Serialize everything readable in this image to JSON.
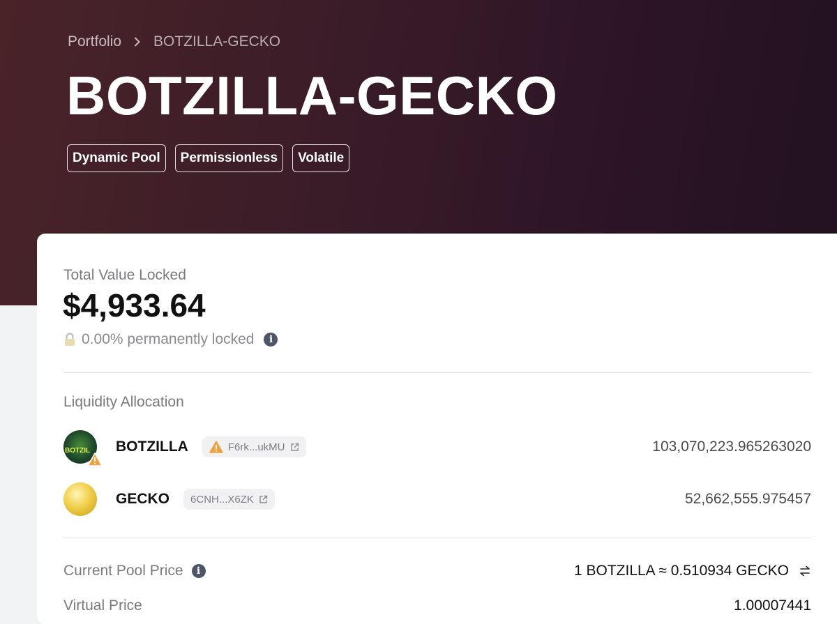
{
  "breadcrumb": {
    "root": "Portfolio",
    "current": "BOTZILLA-GECKO"
  },
  "page_title": "BOTZILLA-GECKO",
  "tags": [
    "Dynamic Pool",
    "Permissionless",
    "Volatile"
  ],
  "tvl": {
    "label": "Total Value Locked",
    "value": "$4,933.64",
    "locked_text": "0.00% permanently locked",
    "info_icon": "info-icon"
  },
  "allocation": {
    "label": "Liquidity Allocation",
    "tokens": [
      {
        "symbol": "BOTZILLA",
        "avatar_text": "BOTZIL",
        "address": "F6rk...ukMU",
        "warning": true,
        "amount": "103,070,223.965263020"
      },
      {
        "symbol": "GECKO",
        "address": "6CNH...X6ZK",
        "warning": false,
        "amount": "52,662,555.975457"
      }
    ]
  },
  "price": {
    "label": "Current Pool Price",
    "value": "1 BOTZILLA ≈ 0.510934 GECKO",
    "swap_icon": "swap-arrows-icon"
  },
  "next_row": {
    "label": "Virtual Price",
    "value": "1.00007441"
  },
  "colors": {
    "hero_start": "#4a2329",
    "hero_end": "#22111f",
    "warning": "#f0a240",
    "info": "#4e5569"
  }
}
